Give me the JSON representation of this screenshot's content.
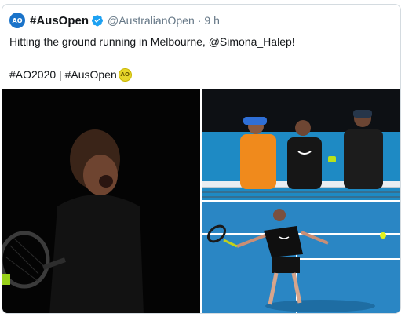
{
  "tweet": {
    "avatar_text": "AO",
    "display_name": "#AusOpen",
    "handle": "@AustralianOpen",
    "separator": "·",
    "time": "9 h",
    "text_line1": "Hitting the ground running in Melbourne, @Simona_Halep!",
    "text_line2": "#AO2020 | #AusOpen",
    "ball_text": "AO"
  },
  "colors": {
    "avatar_bg": "#1a73c9",
    "verified": "#1da1f2",
    "court_blue": "#2a86c4"
  },
  "icons": {
    "verified": "verified-badge-icon",
    "ball": "ao-tennis-ball-emoji"
  }
}
